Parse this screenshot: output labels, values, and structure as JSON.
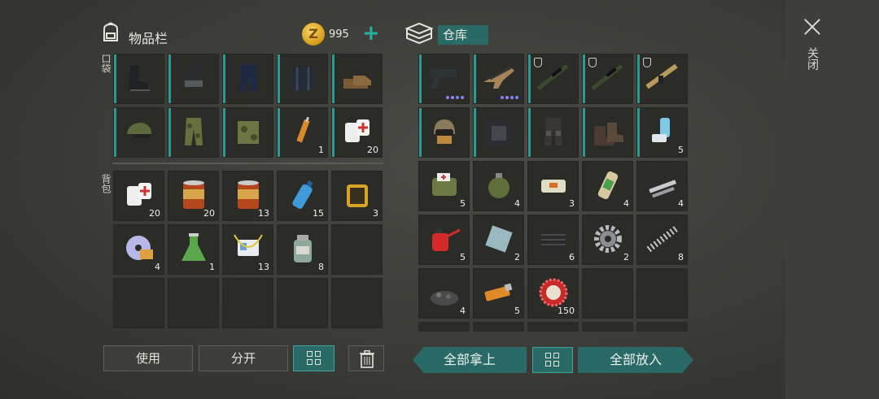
{
  "inventory": {
    "title": "物品栏",
    "coins": "995",
    "pocket_label": "口袋",
    "backpack_label": "背包"
  },
  "storage": {
    "tab_label": "仓库"
  },
  "close_label": "关闭",
  "pocket_slots": [
    {
      "icon": "boots-icon",
      "count": ""
    },
    {
      "icon": "helmet-icon",
      "count": ""
    },
    {
      "icon": "pants-icon",
      "count": ""
    },
    {
      "icon": "vest-icon",
      "count": ""
    },
    {
      "icon": "shoes-icon",
      "count": ""
    },
    {
      "icon": "cap-icon",
      "count": ""
    },
    {
      "icon": "camo-pants-icon",
      "count": ""
    },
    {
      "icon": "camo-vest-icon",
      "count": ""
    },
    {
      "icon": "syringe-icon",
      "count": "1"
    },
    {
      "icon": "bandage-icon",
      "count": "20"
    }
  ],
  "backpack_slots": [
    {
      "icon": "bandage-icon",
      "count": "20"
    },
    {
      "icon": "food-can-icon",
      "count": "20"
    },
    {
      "icon": "food-can-icon",
      "count": "13"
    },
    {
      "icon": "water-bottle-icon",
      "count": "15"
    },
    {
      "icon": "filter-icon",
      "count": "3"
    },
    {
      "icon": "disc-icon",
      "count": "4"
    },
    {
      "icon": "flask-icon",
      "count": "1"
    },
    {
      "icon": "id-card-icon",
      "count": "13"
    },
    {
      "icon": "jar-icon",
      "count": "8"
    },
    {
      "icon": "empty",
      "count": ""
    },
    {
      "icon": "empty",
      "count": ""
    },
    {
      "icon": "empty",
      "count": ""
    },
    {
      "icon": "empty",
      "count": ""
    },
    {
      "icon": "empty",
      "count": ""
    },
    {
      "icon": "empty",
      "count": ""
    }
  ],
  "storage_slots": [
    {
      "icon": "pistol-icon",
      "count": ""
    },
    {
      "icon": "rifle-icon",
      "count": ""
    },
    {
      "icon": "sniper-rifle-icon",
      "count": ""
    },
    {
      "icon": "sniper-rifle-icon",
      "count": ""
    },
    {
      "icon": "assault-rifle-icon",
      "count": ""
    },
    {
      "icon": "armored-helmet-icon",
      "count": ""
    },
    {
      "icon": "armor-vest-icon",
      "count": ""
    },
    {
      "icon": "armor-pants-icon",
      "count": ""
    },
    {
      "icon": "armor-boots-icon",
      "count": ""
    },
    {
      "icon": "inhaler-icon",
      "count": "5"
    },
    {
      "icon": "medkit-bag-icon",
      "count": "5"
    },
    {
      "icon": "grenade-icon",
      "count": "4"
    },
    {
      "icon": "explosive-brick-icon",
      "count": "3"
    },
    {
      "icon": "chemical-tube-icon",
      "count": "4"
    },
    {
      "icon": "pipe-parts-icon",
      "count": "4"
    },
    {
      "icon": "oil-can-icon",
      "count": "5"
    },
    {
      "icon": "metal-plate-icon",
      "count": "2"
    },
    {
      "icon": "rubber-sheet-icon",
      "count": "6"
    },
    {
      "icon": "gear-icon",
      "count": "2"
    },
    {
      "icon": "spring-icon",
      "count": "8"
    },
    {
      "icon": "gravel-icon",
      "count": "4"
    },
    {
      "icon": "usb-drive-icon",
      "count": "5"
    },
    {
      "icon": "bottle-cap-icon",
      "count": "150"
    },
    {
      "icon": "empty",
      "count": ""
    },
    {
      "icon": "empty",
      "count": ""
    }
  ],
  "buttons": {
    "use": "使用",
    "split": "分开",
    "take_all": "全部拿上",
    "put_all": "全部放入"
  }
}
